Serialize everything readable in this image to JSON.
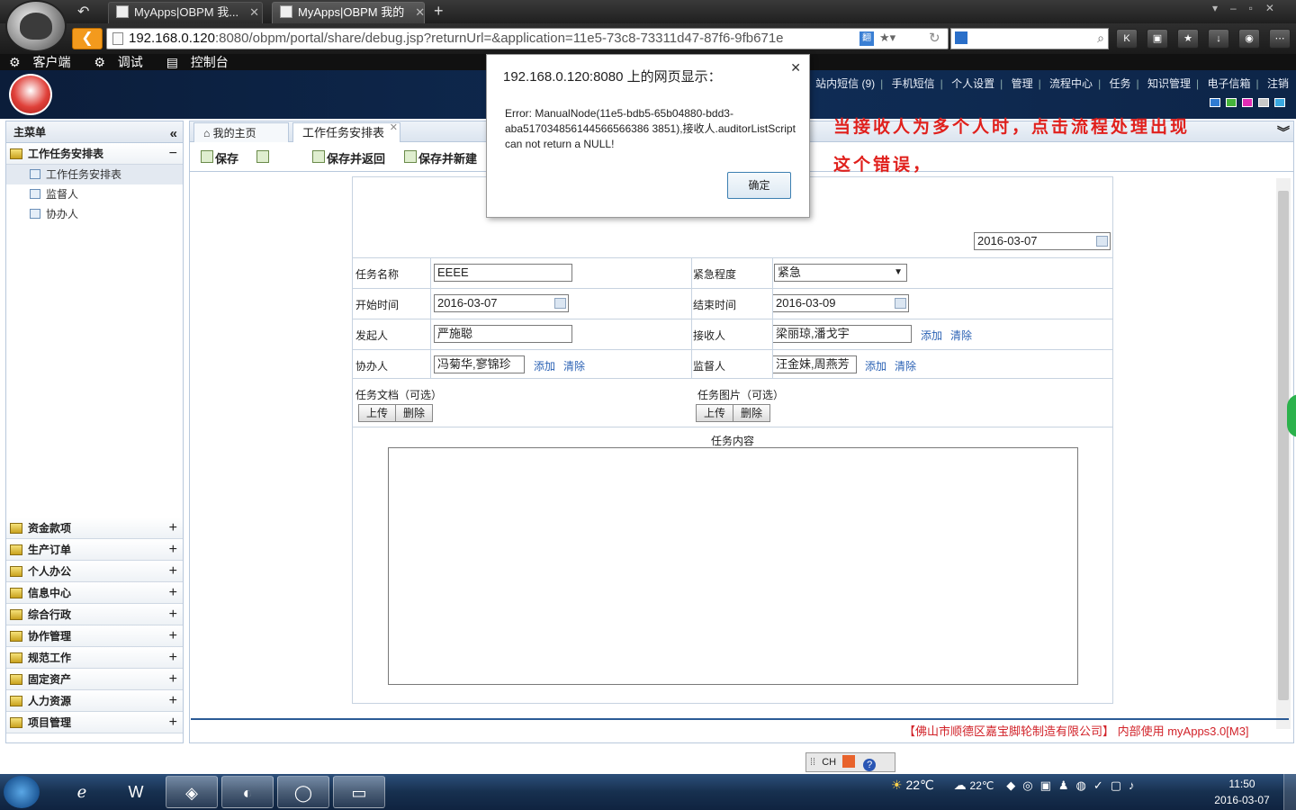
{
  "browser": {
    "tabs": [
      {
        "label": "MyApps|OBPM 我...",
        "active": false
      },
      {
        "label": "MyApps|OBPM 我的",
        "active": true
      }
    ],
    "url_host": "192.168.0.120",
    "url_rest": ":8080/obpm/portal/share/debug.jsp?returnUrl=&application=11e5-73c8-73311d47-87f6-9fb671e",
    "bookmarks": [
      "客户端",
      "调试",
      "控制台"
    ]
  },
  "app": {
    "topnav": [
      "站内短信 (9)",
      "手机短信",
      "个人设置",
      "管理",
      "流程中心",
      "任务",
      "知识管理",
      "电子信箱",
      "注销"
    ],
    "swatch_colors": [
      "#2f7bd2",
      "#45b33a",
      "#e22cb4",
      "#c8c8c8",
      "#3aa8e0"
    ]
  },
  "sidebar": {
    "title": "主菜单",
    "open_group": "工作任务安排表",
    "sub_items": [
      "工作任务安排表",
      "监督人",
      "协办人"
    ],
    "groups": [
      "资金款项",
      "生产订单",
      "个人办公",
      "信息中心",
      "综合行政",
      "协作管理",
      "规范工作",
      "固定资产",
      "人力资源",
      "项目管理"
    ]
  },
  "content_tabs": {
    "home": "我的主页",
    "current": "工作任务安排表"
  },
  "toolbar": {
    "save": "保存",
    "save_return": "保存并返回",
    "save_new": "保存并新建"
  },
  "form": {
    "top_date": "2016-03-07",
    "task_name_label": "任务名称",
    "task_name": "EEEE",
    "urgency_label": "紧急程度",
    "urgency": "紧急",
    "start_label": "开始时间",
    "start": "2016-03-07",
    "end_label": "结束时间",
    "end": "2016-03-09",
    "initiator_label": "发起人",
    "initiator": "严施聪",
    "receiver_label": "接收人",
    "receiver": "梁丽琼,潘戈宇",
    "assistant_label": "协办人",
    "assistant": "冯菊华,寥锦珍",
    "supervisor_label": "监督人",
    "supervisor": "汪金妹,周燕芳",
    "add": "添加",
    "clear": "清除",
    "doc_label": "任务文档（可选）",
    "img_label": "任务图片（可选）",
    "upload": "上传",
    "delete": "删除",
    "content_label": "任务内容"
  },
  "footer_text": "【佛山市顺德区嘉宝脚轮制造有限公司】 内部使用 myApps3.0[M3]",
  "annotation": {
    "line1": "当接收人为多个人时，点击流程处理出现",
    "line2": "这个错误，"
  },
  "dialog": {
    "title": "192.168.0.120:8080 上的网页显示：",
    "message": "Error: ManualNode(11e5-bdb5-65b04880-bdd3-aba517034856144566566386 3851),接收人.auditorListScript can not return a NULL!",
    "ok": "确定"
  },
  "ime": {
    "label": "CH"
  },
  "taskbar": {
    "weather1": "22℃",
    "weather2": "22℃",
    "time": "11:50",
    "date": "2016-03-07"
  }
}
